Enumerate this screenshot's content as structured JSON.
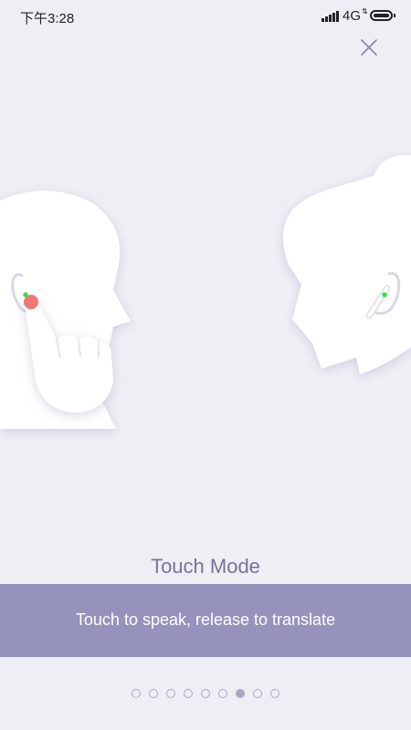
{
  "status_bar": {
    "time": "下午3:28",
    "network": "4G",
    "network_arrows": "⇅"
  },
  "close_icon": "close-icon",
  "illustration": {
    "left_person": "male-head-touching-earbud",
    "right_person": "female-head-with-earbud"
  },
  "mode_title": "Touch Mode",
  "instruction": "Touch to speak, release to translate",
  "pager": {
    "total": 9,
    "active_index": 6
  },
  "colors": {
    "background": "#efeef5",
    "banner": "#9593bb",
    "title_text": "#76749a",
    "indicator": "#a9a8c2",
    "touch_point": "#f07878",
    "earbud_light": "#38e04a"
  }
}
